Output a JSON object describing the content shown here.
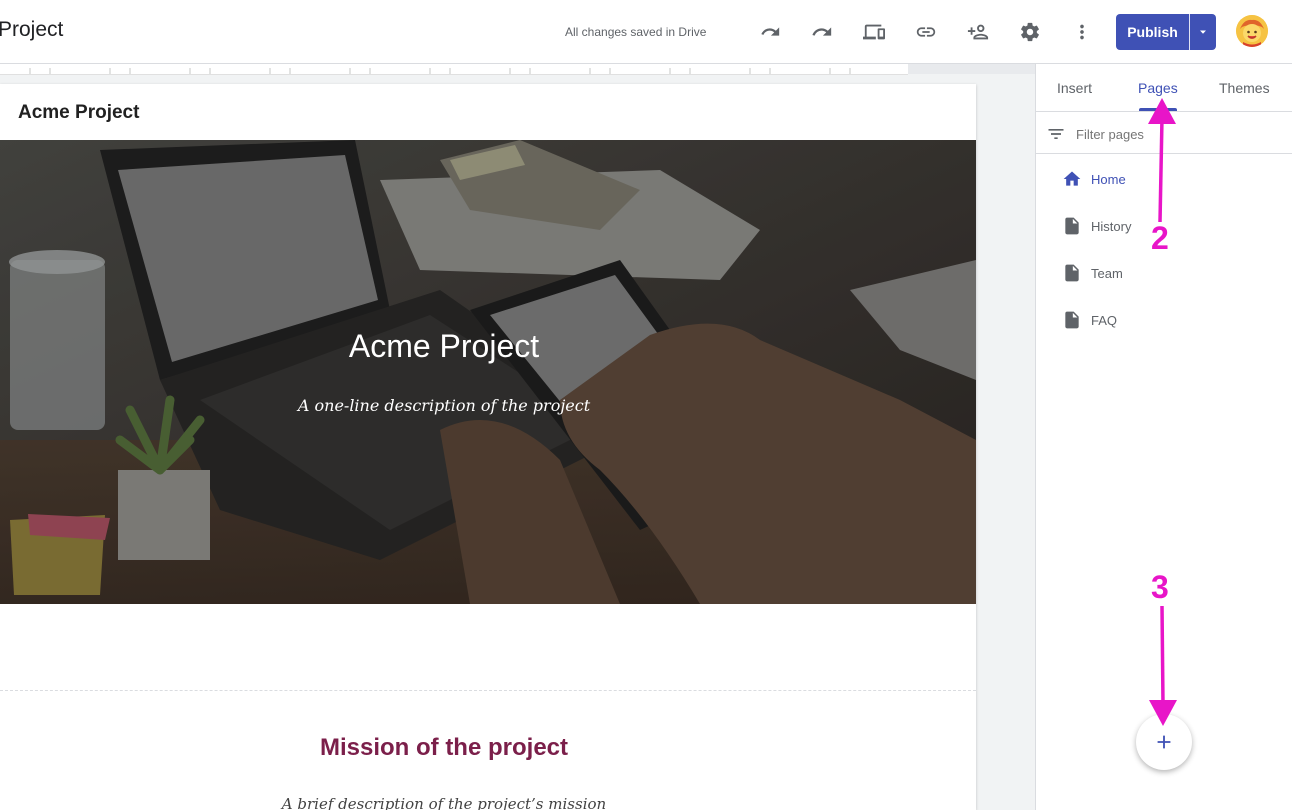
{
  "topbar": {
    "title": "Project",
    "saved_status": "All changes saved in Drive",
    "publish_label": "Publish",
    "icons": [
      "undo-icon",
      "redo-icon",
      "preview-icon",
      "link-icon",
      "share-icon",
      "gear-icon",
      "more-vert-icon"
    ]
  },
  "site": {
    "site_name": "Acme Project",
    "hero_title": "Acme Project",
    "hero_subtitle": "A one-line description of the project",
    "mission_title": "Mission of the project",
    "mission_desc": "A brief description of the project’s mission"
  },
  "panel": {
    "tabs": [
      {
        "label": "Insert",
        "active": false
      },
      {
        "label": "Pages",
        "active": true
      },
      {
        "label": "Themes",
        "active": false
      }
    ],
    "filter_placeholder": "Filter pages",
    "pages": [
      {
        "label": "Home",
        "active": true
      },
      {
        "label": "History",
        "active": false
      },
      {
        "label": "Team",
        "active": false
      },
      {
        "label": "FAQ",
        "active": false
      }
    ]
  },
  "annotations": {
    "step_2": "2",
    "step_3": "3"
  },
  "colors": {
    "accent": "#3f51b5",
    "annotation": "#e815c8",
    "mission_title": "#7b1f4a"
  }
}
